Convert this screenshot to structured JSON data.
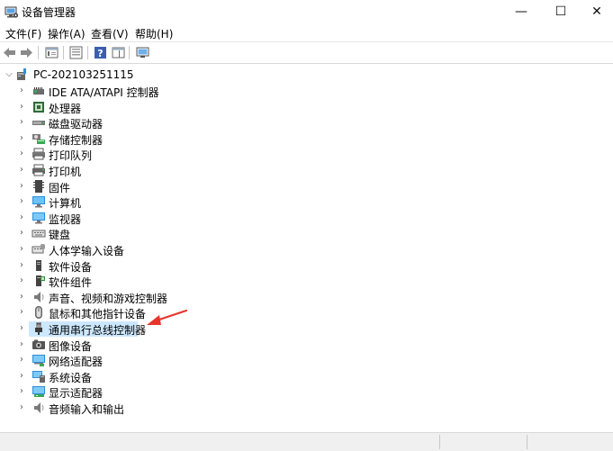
{
  "window": {
    "title": "设备管理器",
    "minimize_glyph": "—",
    "maximize_glyph": "☐",
    "close_glyph": "✕"
  },
  "menu": {
    "file": "文件(F)",
    "action": "操作(A)",
    "view": "查看(V)",
    "help": "帮助(H)"
  },
  "toolbar": {
    "icons": [
      "back-arrow-icon",
      "forward-arrow-icon",
      "properties-icon",
      "show-hide-console-tree-icon",
      "help-icon",
      "action-pane-icon",
      "monitor-scan-icon"
    ]
  },
  "tree": {
    "root_label": "PC-202103251115",
    "items": [
      {
        "label": "IDE ATA/ATAPI 控制器",
        "icon": "ide-controller-icon"
      },
      {
        "label": "处理器",
        "icon": "processor-icon"
      },
      {
        "label": "磁盘驱动器",
        "icon": "disk-drive-icon"
      },
      {
        "label": "存储控制器",
        "icon": "storage-controller-icon"
      },
      {
        "label": "打印队列",
        "icon": "print-queue-icon"
      },
      {
        "label": "打印机",
        "icon": "printer-icon"
      },
      {
        "label": "固件",
        "icon": "firmware-icon"
      },
      {
        "label": "计算机",
        "icon": "computer-icon"
      },
      {
        "label": "监视器",
        "icon": "monitor-icon"
      },
      {
        "label": "键盘",
        "icon": "keyboard-icon"
      },
      {
        "label": "人体学输入设备",
        "icon": "hid-icon"
      },
      {
        "label": "软件设备",
        "icon": "software-device-icon"
      },
      {
        "label": "软件组件",
        "icon": "software-component-icon"
      },
      {
        "label": "声音、视频和游戏控制器",
        "icon": "speaker-icon"
      },
      {
        "label": "鼠标和其他指针设备",
        "icon": "mouse-icon"
      },
      {
        "label": "通用串行总线控制器",
        "icon": "usb-icon"
      },
      {
        "label": "图像设备",
        "icon": "camera-icon"
      },
      {
        "label": "网络适配器",
        "icon": "network-adapter-icon"
      },
      {
        "label": "系统设备",
        "icon": "system-device-icon"
      },
      {
        "label": "显示适配器",
        "icon": "display-adapter-icon"
      },
      {
        "label": "音频输入和输出",
        "icon": "audio-io-icon"
      }
    ],
    "selected_index": 15
  },
  "colors": {
    "selection": "#cce8ff",
    "annotation_arrow": "#e8352b",
    "monitor_blue": "#2f8fd8"
  }
}
